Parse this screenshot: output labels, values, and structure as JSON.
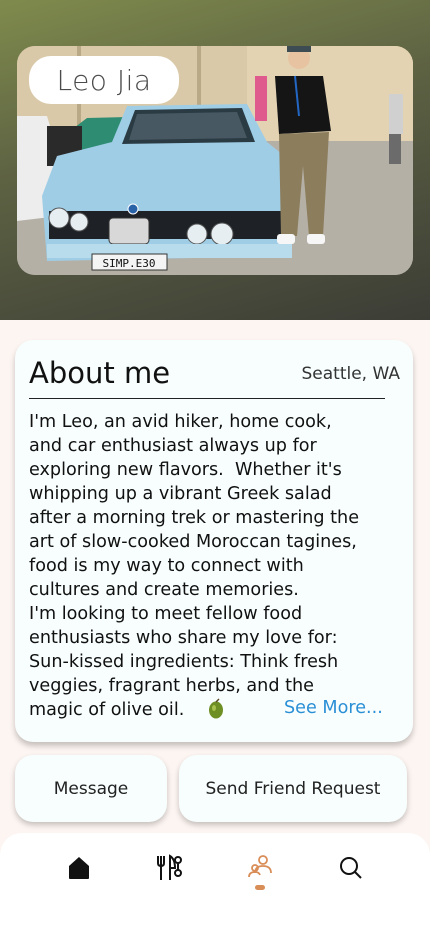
{
  "profile": {
    "name": "Leo Jia",
    "photo_plate": "SIMP.E30"
  },
  "about": {
    "title": "About me",
    "location": "Seattle, WA",
    "bio": "I'm Leo, an avid hiker, home cook,\nand car enthusiast always up for\nexploring new flavors.  Whether it's\nwhipping up a vibrant Greek salad\nafter a morning trek or mastering the\nart of slow-cooked Moroccan tagines,\nfood is my way to connect with\ncultures and create memories.\nI'm looking to meet fellow food\nenthusiasts who share my love for:\nSun-kissed ingredients: Think fresh\nveggies, fragrant herbs, and the\nmagic of olive oil.",
    "see_more": "See More...",
    "emoji_icon": "olive-icon"
  },
  "actions": {
    "message": "Message",
    "friend_request": "Send Friend Request"
  },
  "nav": {
    "items": [
      "home-icon",
      "utensils-icon",
      "people-icon",
      "search-icon"
    ],
    "active": "people-icon",
    "active_color": "#d98d57"
  }
}
